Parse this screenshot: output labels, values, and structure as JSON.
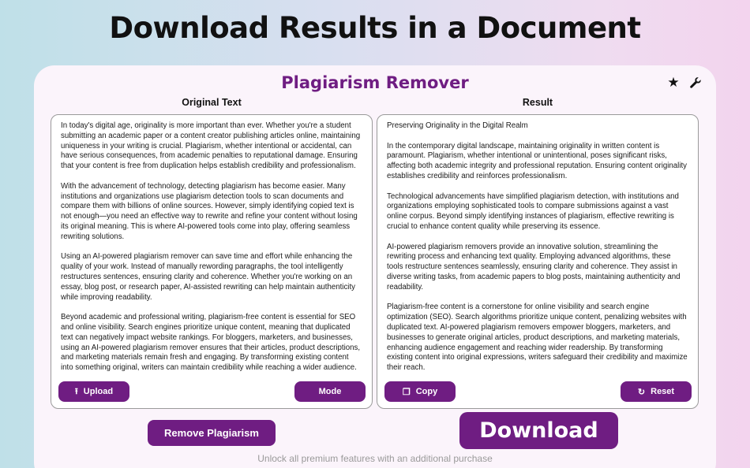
{
  "headline": "Download Results in a Document",
  "app": {
    "title": "Plagiarism Remover",
    "star_icon": "star-icon",
    "settings_icon": "wrench-icon"
  },
  "original": {
    "label": "Original Text",
    "paragraphs": [
      "In today's digital age, originality is more important than ever. Whether you're a student submitting an academic paper or a content creator publishing articles online, maintaining uniqueness in your writing is crucial. Plagiarism, whether intentional or accidental, can have serious consequences, from academic penalties to reputational damage. Ensuring that your content is free from duplication helps establish credibility and professionalism.",
      "With the advancement of technology, detecting plagiarism has become easier. Many institutions and organizations use plagiarism detection tools to scan documents and compare them with billions of online sources. However, simply identifying copied text is not enough—you need an effective way to rewrite and refine your content without losing its original meaning. This is where AI-powered tools come into play, offering seamless rewriting solutions.",
      "Using an AI-powered plagiarism remover can save time and effort while enhancing the quality of your work. Instead of manually rewording paragraphs, the tool intelligently restructures sentences, ensuring clarity and coherence. Whether you're working on an essay, blog post, or research paper, AI-assisted rewriting can help maintain authenticity while improving readability.",
      "Beyond academic and professional writing, plagiarism-free content is essential for SEO and online visibility. Search engines prioritize unique content, meaning that duplicated text can negatively impact website rankings. For bloggers, marketers, and businesses, using an AI-powered plagiarism remover ensures that their articles, product descriptions, and marketing materials remain fresh and engaging. By transforming existing content into something original, writers can maintain credibility while reaching a wider audience."
    ],
    "upload_label": "Upload",
    "mode_label": "Mode"
  },
  "result": {
    "label": "Result",
    "paragraphs": [
      "Preserving Originality in the Digital Realm",
      "In the contemporary digital landscape, maintaining originality in written content is paramount. Plagiarism, whether intentional or unintentional, poses significant risks, affecting both academic integrity and professional reputation. Ensuring content originality establishes credibility and reinforces professionalism.",
      "Technological advancements have simplified plagiarism detection, with institutions and organizations employing sophisticated tools to compare submissions against a vast online corpus. Beyond simply identifying instances of plagiarism, effective rewriting is crucial to enhance content quality while preserving its essence.",
      "AI-powered plagiarism removers provide an innovative solution, streamlining the rewriting process and enhancing text quality. Employing advanced algorithms, these tools restructure sentences seamlessly, ensuring clarity and coherence. They assist in diverse writing tasks, from academic papers to blog posts, maintaining authenticity and readability.",
      "Plagiarism-free content is a cornerstone for online visibility and search engine optimization (SEO). Search algorithms prioritize unique content, penalizing websites with duplicated text. AI-powered plagiarism removers empower bloggers, marketers, and businesses to generate original articles, product descriptions, and marketing materials, enhancing audience engagement and reaching wider readership. By transforming existing content into original expressions, writers safeguard their credibility and maximize their reach."
    ],
    "copy_label": "Copy",
    "reset_label": "Reset"
  },
  "actions": {
    "remove_label": "Remove Plagiarism",
    "download_label": "Download"
  },
  "footnote": "Unlock all premium features with an additional purchase",
  "colors": {
    "accent": "#6f1d82"
  }
}
